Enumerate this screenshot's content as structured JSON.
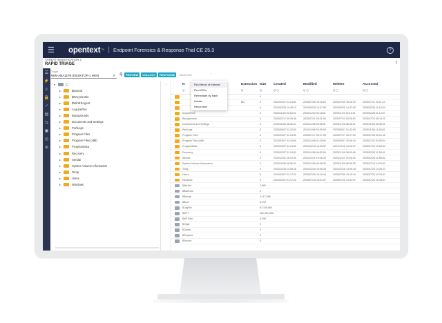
{
  "app": {
    "brand": "opentext",
    "brand_suffix": "™",
    "separator": "|",
    "title": "Endpoint Forensics & Response Trial  CE 25.3",
    "help_icon": "?"
  },
  "investigation": {
    "label": "THREAT INVESTIGATION 1",
    "title": "RAPID TRIAGE",
    "pin_icon": "⇕"
  },
  "toolbar": {
    "select_label": "Target",
    "select_value": "WIN-ABA11P5 (DESKTOP-1 WIN)",
    "clear_icon": "✕",
    "search_icon": "🔍",
    "buttons": [
      "PREVIEW",
      "COLLECT",
      "RESPONSE",
      "ANALYZE"
    ],
    "spinner": "◌"
  },
  "rail_icons": [
    "☰",
    "⚡",
    "⚠",
    "🔒",
    "✓",
    "▤",
    "⇆",
    "▣",
    "◎",
    "⊕"
  ],
  "tree": {
    "root": "C:",
    "items": [
      "$Extend",
      "$Recycle.Bin",
      "$WinREAgent",
      "AcquireRes",
      "Backgrounds",
      "Documents and Settings",
      "PerfLogs",
      "Program Files",
      "Program Files (x86)",
      "ProgramData",
      "Recovery",
      "Sendai",
      "System Volume Information",
      "Temp",
      "Users",
      "Windows"
    ]
  },
  "grid": {
    "columns": [
      "N",
      "Extension",
      "Size",
      "Created",
      "Modified",
      "Written",
      "Accessed"
    ],
    "filters": [
      "Q",
      "Q",
      "Q",
      "Q ▢",
      "Q ▢",
      "Q ▢",
      "Q ▢"
    ],
    "rows": [
      {
        "type": "folder",
        "name": "",
        "ext": "",
        "size": "0",
        "created": "",
        "modified": "",
        "written": "",
        "accessed": ""
      },
      {
        "type": "folder",
        "name": "",
        "ext": "Bin",
        "size": "0",
        "created": "2024/03/07 01:24:50",
        "modified": "2025/07/05 15:16:29",
        "written": "2025/07/05 15:16:29",
        "accessed": "2025/07/11 09:21:24"
      },
      {
        "type": "folder",
        "name": "",
        "ext": "",
        "size": "0",
        "created": "2024/03/25 14:45:12",
        "modified": "2024/03/25 14:47:59",
        "written": "2024/03/25 14:47:59",
        "accessed": "2025/02/28 11:15:04"
      },
      {
        "type": "folder",
        "name": "AcquireRes",
        "ext": "",
        "size": "0",
        "created": "2025/11/20 02:18:01",
        "modified": "2025/11/20 02:18:01",
        "written": "2025/11/20 02:18:01",
        "accessed": "2025/02/28 11:14:57"
      },
      {
        "type": "folder",
        "name": "Backgrounds",
        "ext": "",
        "size": "0",
        "created": "2025/02/17 09:26:46",
        "modified": "2025/07/11 09:21:09",
        "written": "2025/07/11 09:26:52",
        "accessed": "2025/07/22 08:14:20"
      },
      {
        "type": "folder",
        "name": "Documents and Settings",
        "ext": "",
        "size": "0",
        "created": "2025/11/06 08:36:01",
        "modified": "2025/11/06 08:36:01",
        "written": "2025/11/06 08:36:01",
        "accessed": "2025/11/06 08:36:01"
      },
      {
        "type": "folder",
        "name": "PerfLogs",
        "ext": "",
        "size": "0",
        "created": "2025/06/07 01:32:00",
        "modified": "2024/11/06 03:39:09",
        "written": "2025/06/07 01:32:00",
        "accessed": "2025/11/06 16:26:52"
      },
      {
        "type": "folder",
        "name": "Program Files",
        "ext": "",
        "size": "0",
        "created": "2024/03/07 01:24:50",
        "modified": "2025/07/17 00:27:09",
        "written": "2025/07/17 00:27:09",
        "accessed": "2025/07/05 05:21:15"
      },
      {
        "type": "folder",
        "name": "Program Files (x86)",
        "ext": "",
        "size": "0",
        "created": "2024/03/07 01:24:50",
        "modified": "2025/11/06 01:20:00",
        "written": "2025/03/07 20:06:15",
        "accessed": "2025/07/22 02:53:04"
      },
      {
        "type": "folder",
        "name": "ProgramData",
        "ext": "",
        "size": "0",
        "created": "2024/03/07 01:24:50",
        "modified": "2024/12/16 14:05:57",
        "written": "2024/12/16 14:05:57",
        "accessed": "2025/07/20 10:54:42"
      },
      {
        "type": "folder",
        "name": "Recovery",
        "ext": "",
        "size": "0",
        "created": "2025/02/07 01:24:52",
        "modified": "2025/11/06 08:53:06",
        "written": "2025/11/06 08:53:06",
        "accessed": "2025/02/28 11:28:41"
      },
      {
        "type": "folder",
        "name": "Sendai",
        "ext": "",
        "size": "0",
        "created": "2024/12/01 18:32:40",
        "modified": "2024/12/11 19:26:43",
        "written": "2024/12/11 19:26:43",
        "accessed": "2025/02/28 11:55:52"
      },
      {
        "type": "folder",
        "name": "System Volume Information",
        "ext": "",
        "size": "0",
        "created": "2025/11/06 08:36:20",
        "modified": "2025/11/06 08:36:35",
        "written": "2025/11/06 08:36:35",
        "accessed": "2025/07/14 14:23:42"
      },
      {
        "type": "folder",
        "name": "Temp",
        "ext": "",
        "size": "0",
        "created": "2024/12/16 14:06:18",
        "modified": "2024/12/16 14:06:18",
        "written": "2024/12/16 14:06:18",
        "accessed": "2025/07/24 14:26:23"
      },
      {
        "type": "folder",
        "name": "Users",
        "ext": "",
        "size": "0",
        "created": "2024/03/07 01:17:22",
        "modified": "2025/07/05 15:15:16",
        "written": "2025/07/05 15:15:16",
        "accessed": "2025/07/20 10:33:41"
      },
      {
        "type": "folder",
        "name": "Windows",
        "ext": "",
        "size": "0",
        "created": "2024/03/07 01:17:22",
        "modified": "2025/07/15 14:01:57",
        "written": "2025/07/15 14:01:57",
        "accessed": "2025/07/20 10:33:41"
      },
      {
        "type": "file",
        "name": "$AttrDef",
        "ext": "",
        "size": "2,560",
        "created": "",
        "modified": "",
        "written": "",
        "accessed": ""
      },
      {
        "type": "file",
        "name": "$BadClus",
        "ext": "",
        "size": "0",
        "created": "",
        "modified": "",
        "written": "",
        "accessed": ""
      },
      {
        "type": "file",
        "name": "$Bitmap",
        "ext": "",
        "size": "3,117,696",
        "created": "",
        "modified": "",
        "written": "",
        "accessed": ""
      },
      {
        "type": "file",
        "name": "$Boot",
        "ext": "",
        "size": "8,192",
        "created": "",
        "modified": "",
        "written": "",
        "accessed": ""
      },
      {
        "type": "file",
        "name": "$LogFile",
        "ext": "",
        "size": "67,108,864",
        "created": "",
        "modified": "",
        "written": "",
        "accessed": ""
      },
      {
        "type": "file",
        "name": "$MFT",
        "ext": "",
        "size": "262,381,056",
        "created": "",
        "modified": "",
        "written": "",
        "accessed": ""
      },
      {
        "type": "file",
        "name": "$MFTMirr",
        "ext": "",
        "size": "4,096",
        "created": "",
        "modified": "",
        "written": "",
        "accessed": ""
      },
      {
        "type": "file",
        "name": "$Objid",
        "ext": "",
        "size": "0",
        "created": "",
        "modified": "",
        "written": "",
        "accessed": ""
      },
      {
        "type": "file",
        "name": "$Quota",
        "ext": "",
        "size": "0",
        "created": "",
        "modified": "",
        "written": "",
        "accessed": ""
      },
      {
        "type": "file",
        "name": "$Reparse",
        "ext": "",
        "size": "0",
        "created": "",
        "modified": "",
        "written": "",
        "accessed": ""
      },
      {
        "type": "file",
        "name": "$Secure",
        "ext": "",
        "size": "0",
        "created": "",
        "modified": "",
        "written": "",
        "accessed": ""
      }
    ]
  },
  "menu": {
    "items": [
      "Find Items of Interest",
      "Find IOCs",
      "Remediate by hash",
      "Isolate",
      "Reconnect"
    ]
  }
}
